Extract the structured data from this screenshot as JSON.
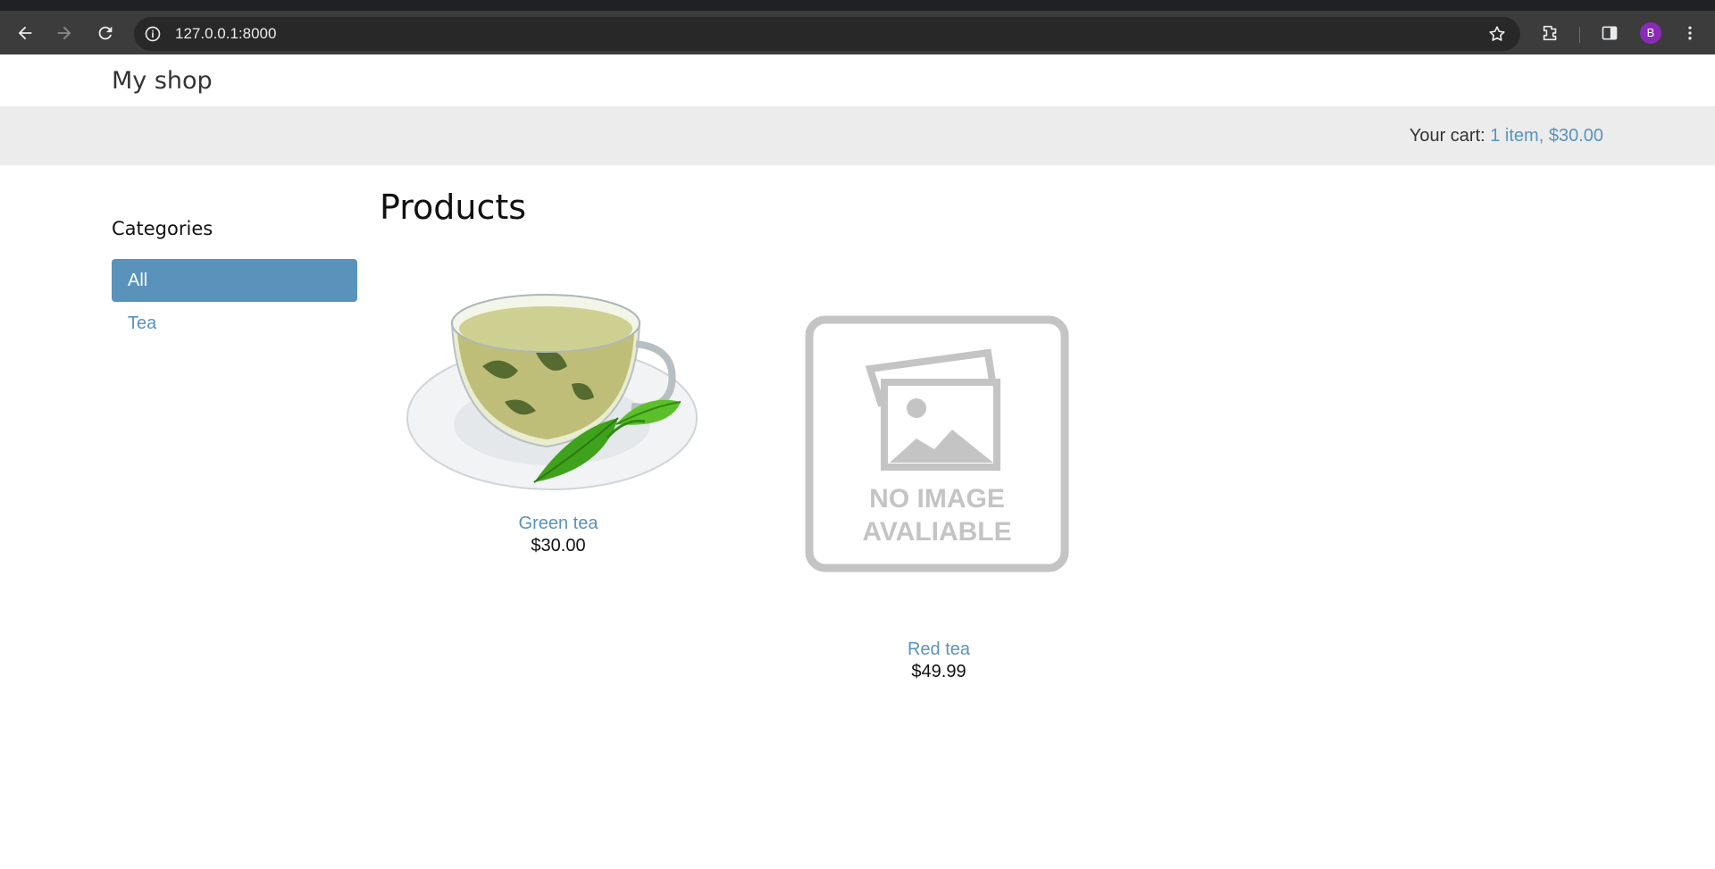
{
  "browser": {
    "url": "127.0.0.1:8000",
    "profile_initial": "B"
  },
  "header": {
    "logo": "My shop"
  },
  "cart": {
    "label": "Your cart:",
    "summary": "1 item, $30.00"
  },
  "sidebar": {
    "title": "Categories",
    "items": [
      {
        "label": "All",
        "active": true
      },
      {
        "label": "Tea",
        "active": false
      }
    ]
  },
  "main": {
    "title": "Products",
    "products": [
      {
        "name": "Green tea",
        "price": "$30.00",
        "image": "green-tea-cup"
      },
      {
        "name": "Red tea",
        "price": "$49.99",
        "image": "no-image-placeholder",
        "placeholder_text": [
          "NO IMAGE",
          "AVALIABLE"
        ]
      }
    ]
  },
  "colors": {
    "accent": "#5993bb",
    "subheader_bg": "#ececec",
    "browser_bg": "#3c3c3c"
  }
}
